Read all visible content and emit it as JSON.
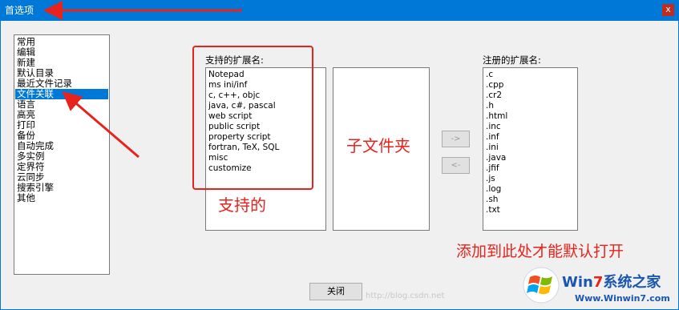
{
  "window": {
    "title": "首选项",
    "close_glyph": "x"
  },
  "categories": [
    {
      "label": "常用",
      "selected": false
    },
    {
      "label": "编辑",
      "selected": false
    },
    {
      "label": "新建",
      "selected": false
    },
    {
      "label": "默认目录",
      "selected": false
    },
    {
      "label": "最近文件记录",
      "selected": false
    },
    {
      "label": "文件关联",
      "selected": true
    },
    {
      "label": "语言",
      "selected": false
    },
    {
      "label": "高亮",
      "selected": false
    },
    {
      "label": "打印",
      "selected": false
    },
    {
      "label": "备份",
      "selected": false
    },
    {
      "label": "自动完成",
      "selected": false
    },
    {
      "label": "多实例",
      "selected": false
    },
    {
      "label": "定界符",
      "selected": false
    },
    {
      "label": "云同步",
      "selected": false
    },
    {
      "label": "搜索引擎",
      "selected": false
    },
    {
      "label": "其他",
      "selected": false
    }
  ],
  "supported": {
    "label": "支持的扩展名:",
    "items": [
      "Notepad",
      "ms ini/inf",
      "c, c++, objc",
      "java, c#, pascal",
      "web script",
      "public script",
      "property script",
      "fortran, TeX, SQL",
      "misc",
      "customize"
    ]
  },
  "subfolder_list": {
    "items": []
  },
  "registered": {
    "label": "注册的扩展名:",
    "items": [
      ".c",
      ".cpp",
      ".cr2",
      ".h",
      ".html",
      ".inc",
      ".inf",
      ".ini",
      ".java",
      ".jfif",
      ".js",
      ".log",
      ".sh",
      ".txt"
    ]
  },
  "buttons": {
    "add": "->",
    "remove": "<-",
    "close": "关闭"
  },
  "annotations": {
    "supported": "支持的",
    "subfolder": "子文件夹",
    "add_here": "添加到此处才能默认打开",
    "color": "#e8221c"
  },
  "watermark": {
    "brand_win": "Win",
    "brand_7": "7",
    "brand_rest": "系统之家",
    "url": "Www.Winwin7.com",
    "blog": "http://blog.csdn.net"
  }
}
